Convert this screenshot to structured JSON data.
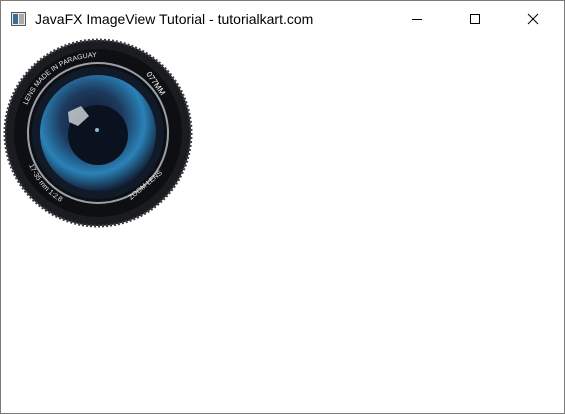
{
  "window": {
    "title": "JavaFX ImageView Tutorial - tutorialkart.com",
    "controls": {
      "minimize": "minimize",
      "maximize": "maximize",
      "close": "close"
    }
  },
  "image": {
    "description_icon": "camera-lens-image",
    "lettering_top": "LENS MADE IN PARAGUAY",
    "lettering_right": "077MM",
    "lettering_bottom": "17-35 mm 1:2.8",
    "lettering_bottom_right": "ZOOM LENS"
  }
}
